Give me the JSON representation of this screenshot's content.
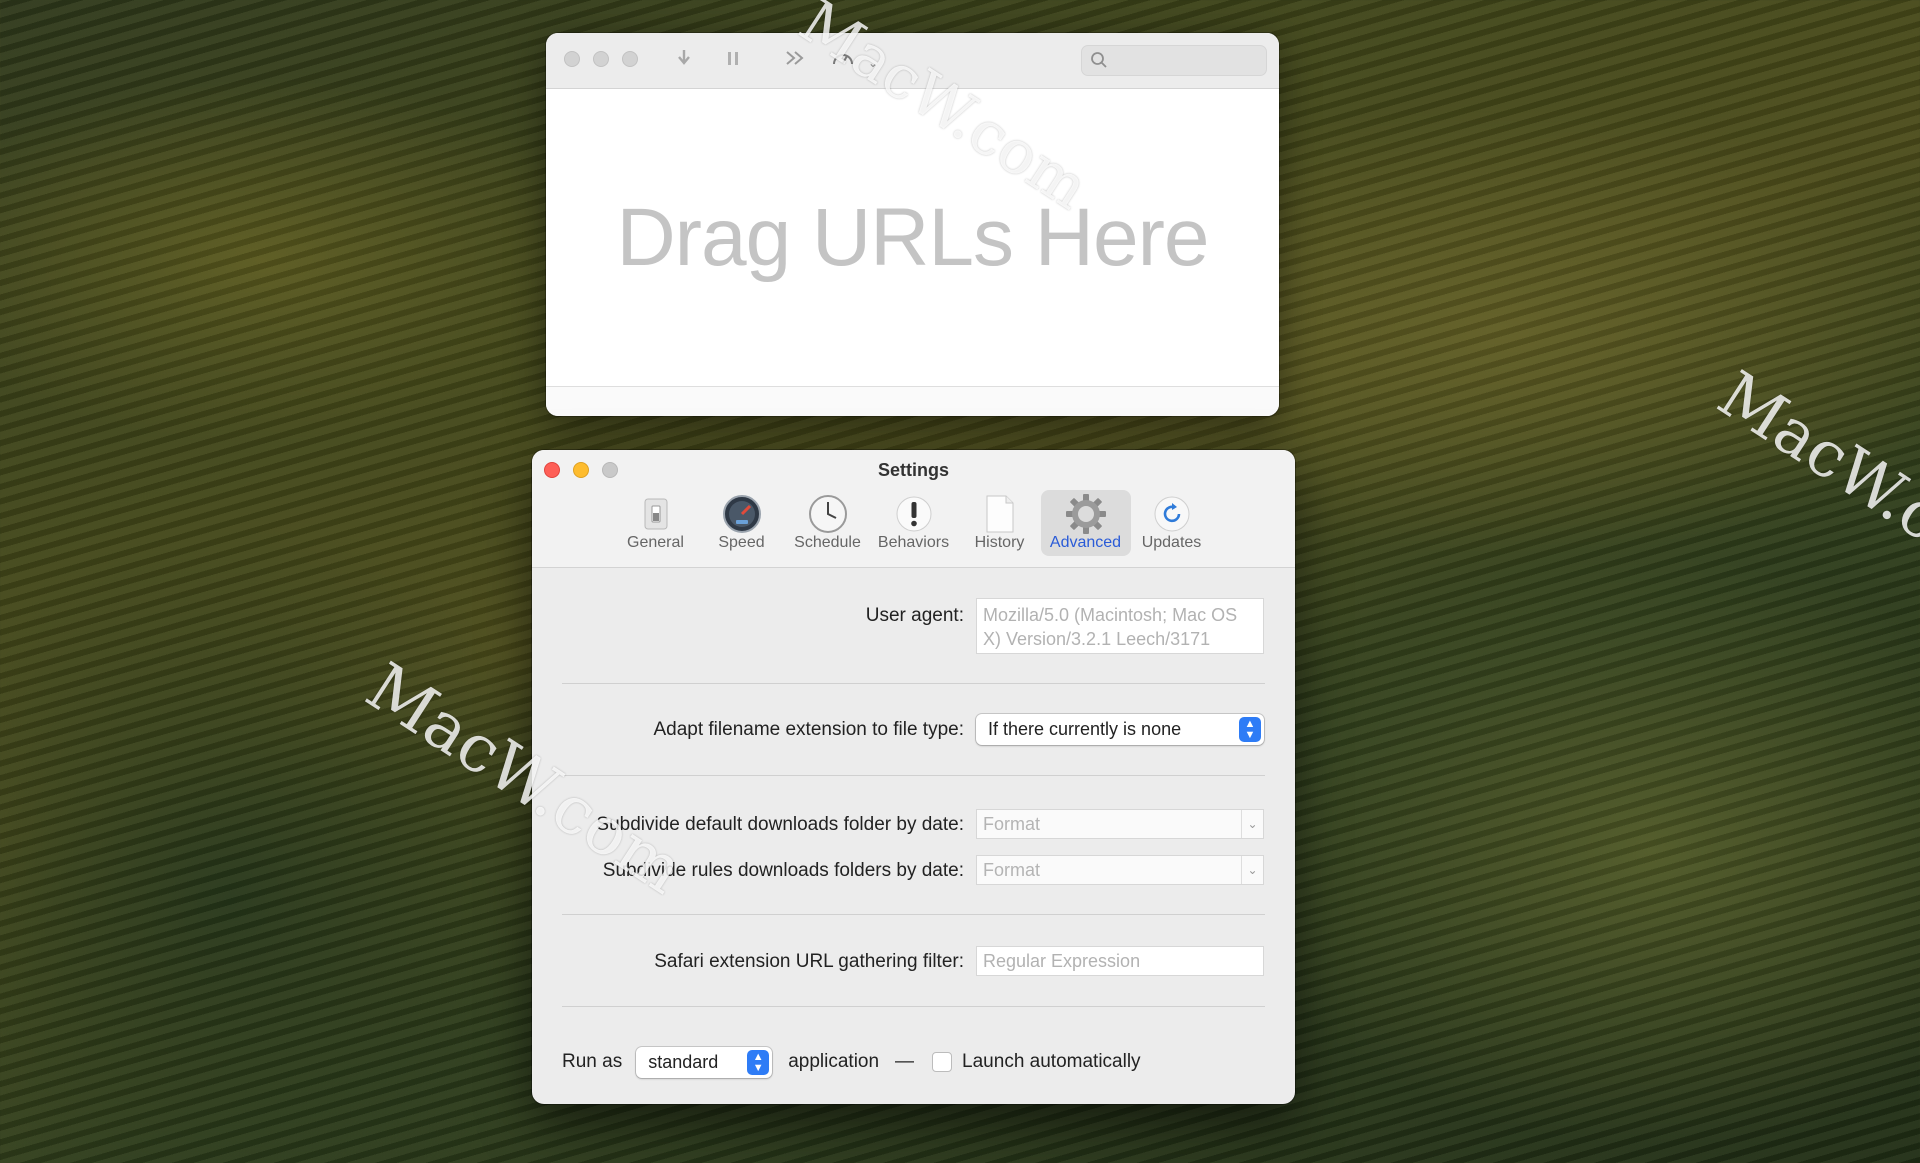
{
  "watermark": {
    "text": "MacW.com",
    "partial": "MacW.c"
  },
  "main_window": {
    "toolbar_icons": [
      "download-icon",
      "pause-icon",
      "fast-forward-icon",
      "speed-gauge-icon",
      "speed-menu-chevron-icon",
      "search-icon"
    ],
    "drop_placeholder": "Drag URLs Here"
  },
  "settings": {
    "title": "Settings",
    "tabs": [
      {
        "label": "General",
        "icon": "switch-icon"
      },
      {
        "label": "Speed",
        "icon": "speedometer-icon"
      },
      {
        "label": "Schedule",
        "icon": "clock-icon"
      },
      {
        "label": "Behaviors",
        "icon": "exclamation-icon"
      },
      {
        "label": "History",
        "icon": "document-icon"
      },
      {
        "label": "Advanced",
        "icon": "gear-icon",
        "active": true
      },
      {
        "label": "Updates",
        "icon": "refresh-icon"
      }
    ],
    "user_agent": {
      "label": "User agent:",
      "placeholder": "Mozilla/5.0 (Macintosh; Mac OS X) Version/3.2.1 Leech/3171"
    },
    "adapt_extension": {
      "label": "Adapt filename extension to file type:",
      "value": "If there currently is none"
    },
    "subdivide_default": {
      "label": "Subdivide default downloads folder by date:",
      "placeholder": "Format"
    },
    "subdivide_rules": {
      "label": "Subdivide rules downloads folders by date:",
      "placeholder": "Format"
    },
    "safari_filter": {
      "label": "Safari extension URL gathering filter:",
      "placeholder": "Regular Expression"
    },
    "run_as": {
      "prefix": "Run as",
      "value": "standard",
      "suffix": "application",
      "dash": "—",
      "launch_label": "Launch automatically",
      "launch_checked": false
    }
  },
  "colors": {
    "accent": "#2e7cf6",
    "active_tab_text": "#2a5bd7",
    "close": "#fe5f57",
    "minimize": "#febc2e"
  }
}
